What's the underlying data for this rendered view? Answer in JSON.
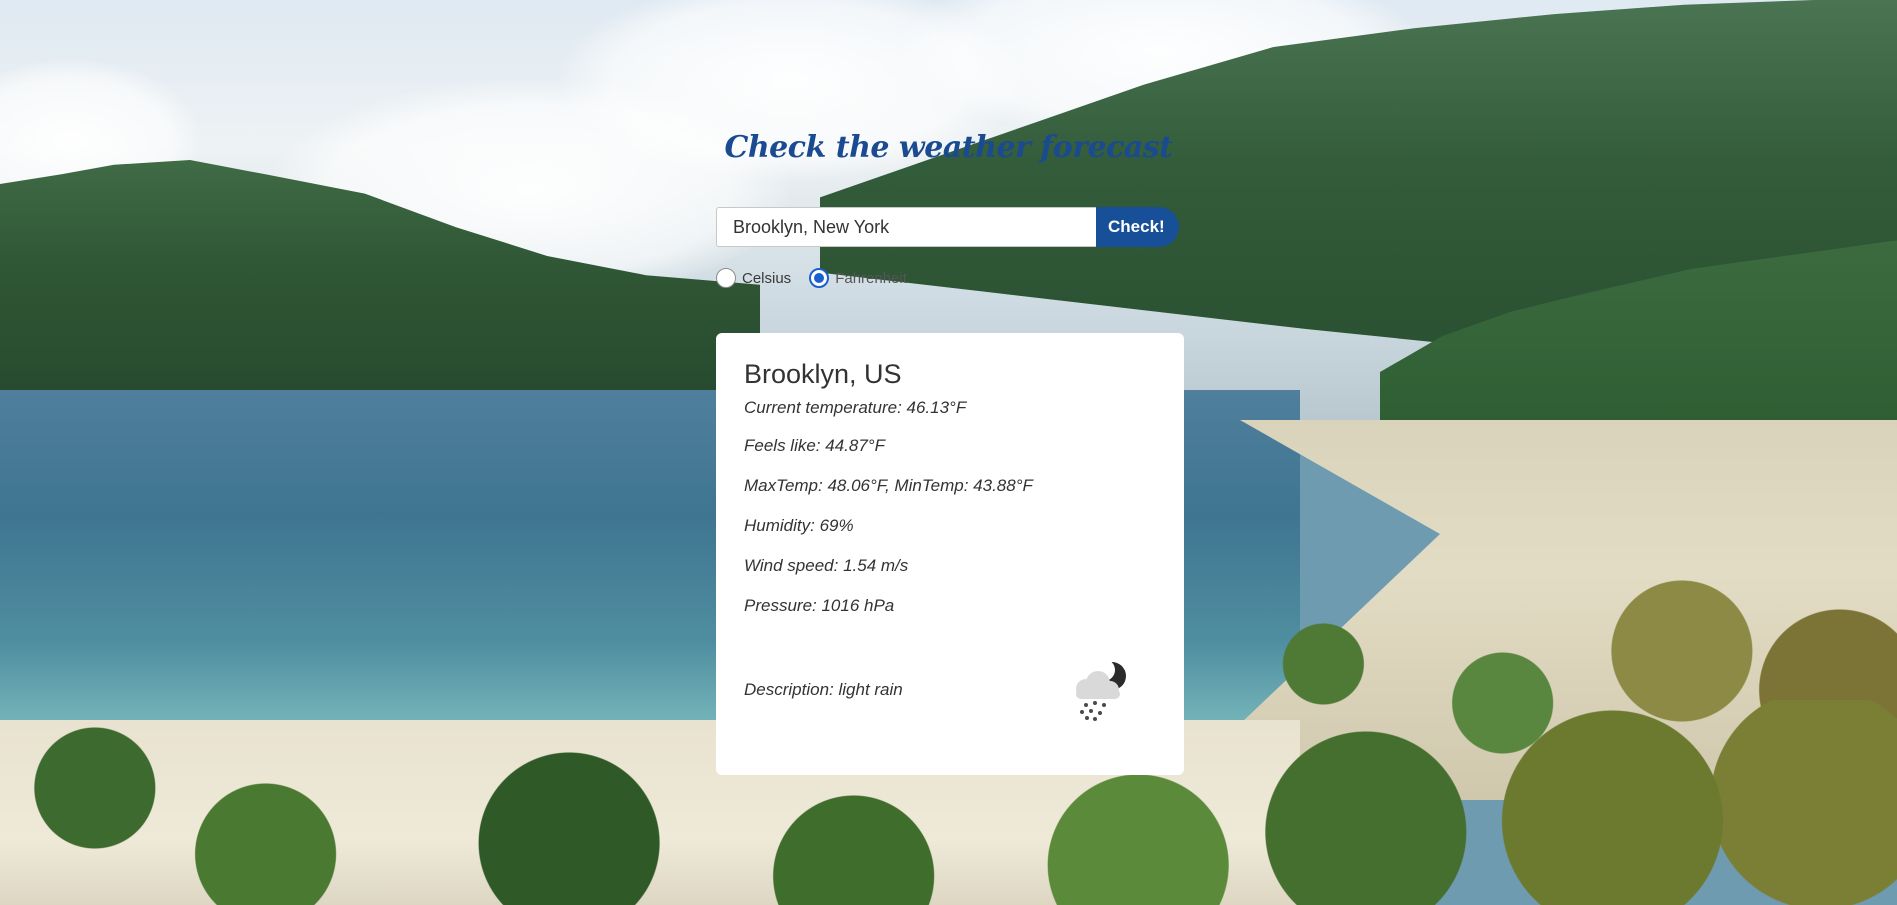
{
  "header": {
    "title": "Check the weather forecast"
  },
  "search": {
    "value": "Brooklyn, New York",
    "button_label": "Check!"
  },
  "units": {
    "options": [
      "Celsius",
      "Fahrenheit"
    ],
    "selected": "Fahrenheit"
  },
  "result": {
    "location": "Brooklyn, US",
    "current_temperature": "Current temperature: 46.13°F",
    "feels_like": "Feels like: 44.87°F",
    "max_min": "MaxTemp: 48.06°F, MinTemp: 43.88°F",
    "humidity": "Humidity: 69%",
    "wind_speed": "Wind speed: 1.54 m/s",
    "pressure": "Pressure: 1016 hPa",
    "description": "Description: light rain",
    "icon": "cloud-moon-rain-icon"
  },
  "colors": {
    "title": "#1a4a8f",
    "button": "#174f98",
    "radio_checked": "#1a5fd0"
  }
}
